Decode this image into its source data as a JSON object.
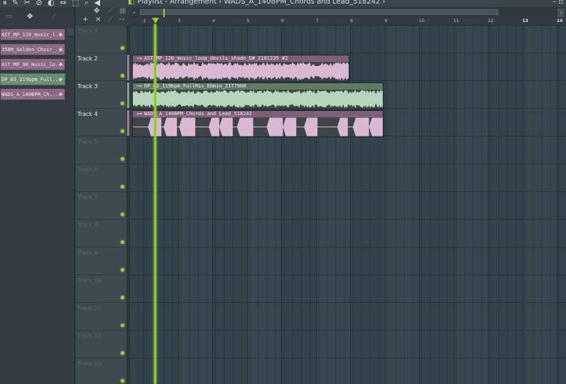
{
  "window": {
    "title": "Playlist - Arrangement › WADS_A_140BPM_Chords and Lead_518242 ›"
  },
  "picker": {
    "items": [
      {
        "label": "AST_MP_120_music_l...",
        "selected": false
      },
      {
        "label": "358M_Golden_Choir_...",
        "selected": false
      },
      {
        "label": "AST_MP_90_music_lo...",
        "selected": false
      },
      {
        "label": "DP_03_119bpm_Full...",
        "selected": true
      },
      {
        "label": "WADS_A_140BPM_Ch...",
        "selected": false
      }
    ]
  },
  "ruler": {
    "ticks": [
      "2",
      "3",
      "4",
      "5",
      "6",
      "7",
      "8",
      "9",
      "10",
      "11",
      "12",
      "13",
      "14"
    ]
  },
  "tracks": [
    {
      "name": "Track 1",
      "active": false
    },
    {
      "name": "Track 2",
      "active": true
    },
    {
      "name": "Track 3",
      "active": true
    },
    {
      "name": "Track 4",
      "active": true
    },
    {
      "name": "Track 5",
      "active": false
    },
    {
      "name": "Track 6",
      "active": false
    },
    {
      "name": "Track 7",
      "active": false
    },
    {
      "name": "Track 8",
      "active": false
    },
    {
      "name": "Track 9",
      "active": false
    },
    {
      "name": "Track 10",
      "active": false
    },
    {
      "name": "Track 11",
      "active": false
    },
    {
      "name": "Track 12",
      "active": false
    },
    {
      "name": "Track 13",
      "active": false
    }
  ],
  "clips": [
    {
      "track": 2,
      "label": "AST_MP_120_music_loop_devils_shade_D#_2101235 #2",
      "color": "pink",
      "pattern": "dense"
    },
    {
      "track": 3,
      "label": "DP_03_119bpm_FullMix_Ebmin_2177908",
      "color": "green",
      "pattern": "dense"
    },
    {
      "track": 4,
      "label": "WADS_A_140BPM_Chords and Lead_518242",
      "color": "pink",
      "pattern": "blocks"
    }
  ],
  "colors": {
    "accent": "#9ccc3c",
    "clip_pink": "#d9b8d4",
    "clip_green": "#b8d4bc"
  }
}
